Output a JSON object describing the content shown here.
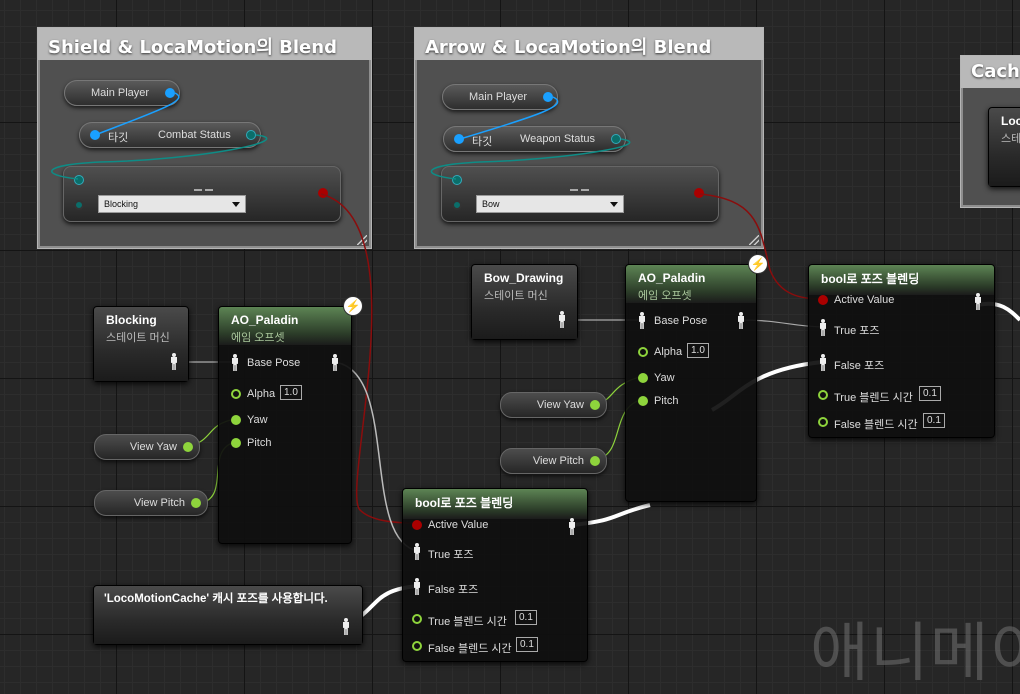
{
  "comments": {
    "shield": "Shield & LocaMotion의 Blend",
    "arrow": "Arrow & LocaMotion의 Blend",
    "cache": "Cach"
  },
  "shield_group": {
    "main_player": "Main Player",
    "target": "타깃",
    "status": "Combat Status",
    "dropdown": "Blocking"
  },
  "arrow_group": {
    "main_player": "Main Player",
    "target": "타깃",
    "status": "Weapon Status",
    "dropdown": "Bow"
  },
  "cache_node": {
    "title": "Loco",
    "sub": "스테이"
  },
  "blocking_sm": {
    "title": "Blocking",
    "sub": "스테이트 머신"
  },
  "bow_sm": {
    "title": "Bow_Drawing",
    "sub": "스테이트 머신"
  },
  "ao_left": {
    "title": "AO_Paladin",
    "sub": "에임 오프셋",
    "base_pose": "Base Pose",
    "alpha": "Alpha",
    "alpha_val": "1.0",
    "yaw": "Yaw",
    "pitch": "Pitch"
  },
  "ao_right": {
    "title": "AO_Paladin",
    "sub": "에임 오프셋",
    "base_pose": "Base Pose",
    "alpha": "Alpha",
    "alpha_val": "1.0",
    "yaw": "Yaw",
    "pitch": "Pitch"
  },
  "getters": {
    "view_yaw": "View Yaw",
    "view_pitch": "View Pitch"
  },
  "blend_bottom": {
    "title": "bool로 포즈 블렌딩",
    "active": "Active Value",
    "true_pose": "True 포즈",
    "false_pose": "False 포즈",
    "true_time": "True 블렌드 시간",
    "true_time_val": "0.1",
    "false_time": "False 블렌드 시간",
    "false_time_val": "0.1"
  },
  "blend_right": {
    "title": "bool로 포즈 블렌딩",
    "active": "Active Value",
    "true_pose": "True 포즈",
    "false_pose": "False 포즈",
    "true_time": "True 블렌드 시간",
    "true_time_val": "0.1",
    "false_time": "False 블렌드 시간",
    "false_time_val": "0.1"
  },
  "cache_use": {
    "title": "'LocoMotionCache' 캐시 포즈를 사용합니다."
  },
  "watermark": "애니메이"
}
